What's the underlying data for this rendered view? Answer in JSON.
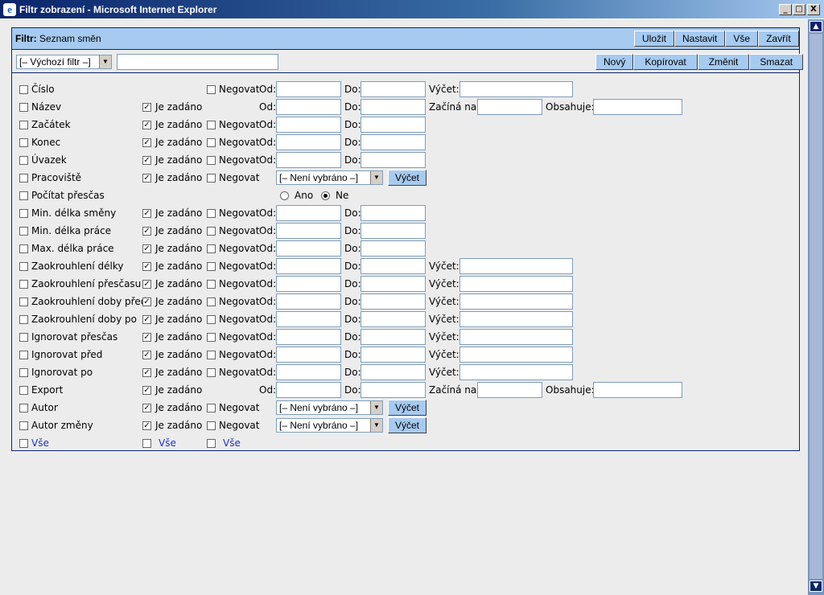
{
  "window": {
    "title": "Filtr zobrazení - Microsoft Internet Explorer",
    "min_glyph": "_",
    "max_glyph": "□",
    "close_glyph": "X"
  },
  "header": {
    "label_bold": "Filtr:",
    "label_text": " Seznam směn",
    "buttons": [
      "Uložit",
      "Nastavit",
      "Vše",
      "Zavřít"
    ]
  },
  "toolbar": {
    "filter_select": "[– Výchozí filtr –]",
    "filter_name_value": "",
    "buttons": [
      "Nový",
      "Kopírovat",
      "Změnit",
      "Smazat"
    ]
  },
  "labels": {
    "je_zadano": "Je zadáno",
    "negovat": "Negovat",
    "od": "Od:",
    "do": "Do:",
    "vycet": "Výčet:",
    "zacina_na": "Začíná na:",
    "obsahuje": "Obsahuje:",
    "vycet_button": "Výčet",
    "neni_vybrano": "[– Není vybráno –]",
    "ano": "Ano",
    "ne": "Ne",
    "vse": "Vše"
  },
  "fields": [
    {
      "name": "Číslo"
    },
    {
      "name": "Název"
    },
    {
      "name": "Začátek"
    },
    {
      "name": "Konec"
    },
    {
      "name": "Úvazek"
    },
    {
      "name": "Pracoviště"
    },
    {
      "name": "Počítat přesčas"
    },
    {
      "name": "Min. délka směny"
    },
    {
      "name": "Min. délka práce"
    },
    {
      "name": "Max. délka práce"
    },
    {
      "name": "Zaokrouhlení délky"
    },
    {
      "name": "Zaokrouhlení přesčasu"
    },
    {
      "name": "Zaokrouhlení doby před"
    },
    {
      "name": "Zaokrouhlení doby po"
    },
    {
      "name": "Ignorovat přesčas"
    },
    {
      "name": "Ignorovat před"
    },
    {
      "name": "Ignorovat po"
    },
    {
      "name": "Export"
    },
    {
      "name": "Autor"
    },
    {
      "name": "Autor změny"
    }
  ],
  "colors": {
    "header_bg": "#a6caf0",
    "border": "#0a246a",
    "link": "#1a2fd0"
  }
}
